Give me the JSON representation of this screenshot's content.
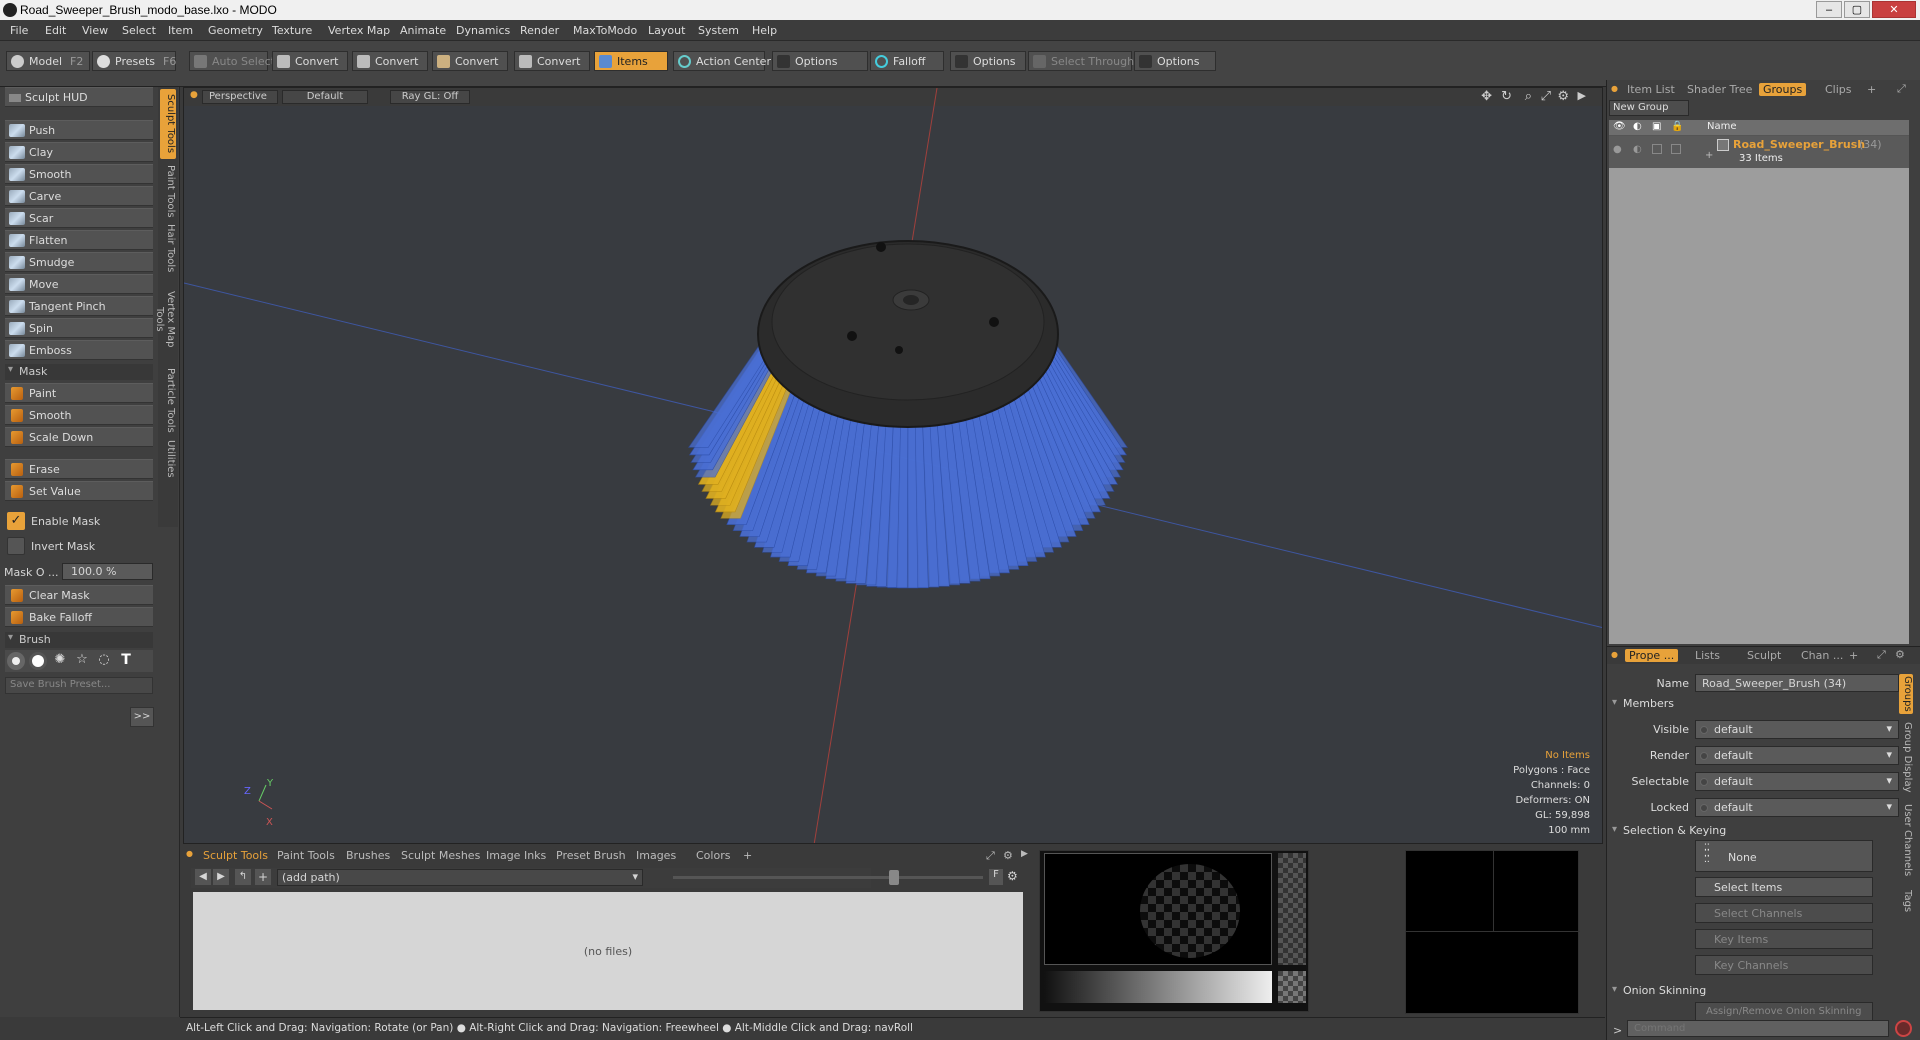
{
  "window": {
    "title": "Road_Sweeper_Brush_modo_base.lxo - MODO"
  },
  "menu": [
    "File",
    "Edit",
    "View",
    "Select",
    "Item",
    "Geometry",
    "Texture",
    "Vertex Map",
    "Animate",
    "Dynamics",
    "Render",
    "MaxToModo",
    "Layout",
    "System",
    "Help"
  ],
  "toolbar": {
    "model": "Model",
    "model_key": "F2",
    "presets": "Presets",
    "presets_key": "F6",
    "auto_select": "Auto Select",
    "convert1": "Convert",
    "convert2": "Convert",
    "convert3": "Convert",
    "convert4": "Convert",
    "items": "Items",
    "action_center": "Action Center",
    "options1": "Options",
    "falloff": "Falloff",
    "options2": "Options",
    "select_through": "Select Through",
    "options3": "Options"
  },
  "left": {
    "hud": "Sculpt HUD",
    "tools": [
      "Push",
      "Clay",
      "Smooth",
      "Carve",
      "Scar",
      "Flatten",
      "Smudge",
      "Move",
      "Tangent Pinch",
      "Spin",
      "Emboss"
    ],
    "mask_header": "Mask",
    "mask_tools": [
      "Paint",
      "Smooth",
      "Scale Down"
    ],
    "erase": "Erase",
    "set_value": "Set Value",
    "enable_mask": "Enable Mask",
    "invert_mask": "Invert Mask",
    "mask_opacity_label": "Mask O ...",
    "mask_opacity_value": "100.0 %",
    "clear_mask": "Clear Mask",
    "bake_falloff": "Bake Falloff",
    "brush_header": "Brush",
    "save_preset": "Save Brush Preset...",
    "expand": ">>"
  },
  "side_tabs": [
    "Sculpt Tools",
    "Paint Tools",
    "Hair Tools",
    "Vertex Map Tools",
    "Particle Tools",
    "Utilities"
  ],
  "viewport": {
    "view": "Perspective",
    "shading": "Default",
    "raygl": "Ray GL: Off",
    "info": {
      "items": "No Items",
      "polygons": "Polygons : Face",
      "channels": "Channels: 0",
      "deformers": "Deformers: ON",
      "gl": "GL: 59,898",
      "scale": "100 mm"
    },
    "axis_y": "Y",
    "axis_z": "Z",
    "axis_x": "X"
  },
  "bottom": {
    "tabs": [
      "Sculpt Tools",
      "Paint Tools",
      "Brushes",
      "Sculpt Meshes",
      "Image Inks",
      "Preset Brush",
      "Images",
      "Colors"
    ],
    "path": "(add path)",
    "empty": "(no files)",
    "f_label": "F"
  },
  "status": "Alt-Left Click and Drag: Navigation: Rotate (or Pan) ● Alt-Right Click and Drag: Navigation: Freewheel ● Alt-Middle Click and Drag: navRoll",
  "right": {
    "top_tabs": [
      "Item List",
      "Shader Tree",
      "Groups",
      "Clips"
    ],
    "new_group": "New Group",
    "col_name": "Name",
    "group_name": "Road_Sweeper_Brush",
    "group_count": "(34)",
    "group_items": "33 Items",
    "prop_tabs": [
      "Prope ...",
      "Lists",
      "Sculpt",
      "Chan ..."
    ],
    "name_label": "Name",
    "name_value": "Road_Sweeper_Brush (34)",
    "members": "Members",
    "visible": "Visible",
    "render": "Render",
    "selectable": "Selectable",
    "locked": "Locked",
    "default": "default",
    "sel_keying": "Selection & Keying",
    "none": "None",
    "select_items": "Select Items",
    "select_channels": "Select Channels",
    "key_items": "Key Items",
    "key_channels": "Key Channels",
    "onion": "Onion Skinning",
    "onion_btn": "Assign/Remove Onion Skinning",
    "vtabs": [
      "Groups",
      "Group Display",
      "User Channels",
      "Tags"
    ],
    "command_placeholder": "Command"
  },
  "colors": {
    "accent": "#e8a23a",
    "bristle": "#4a6fd4",
    "bristle_highlight": "#e0b020"
  }
}
